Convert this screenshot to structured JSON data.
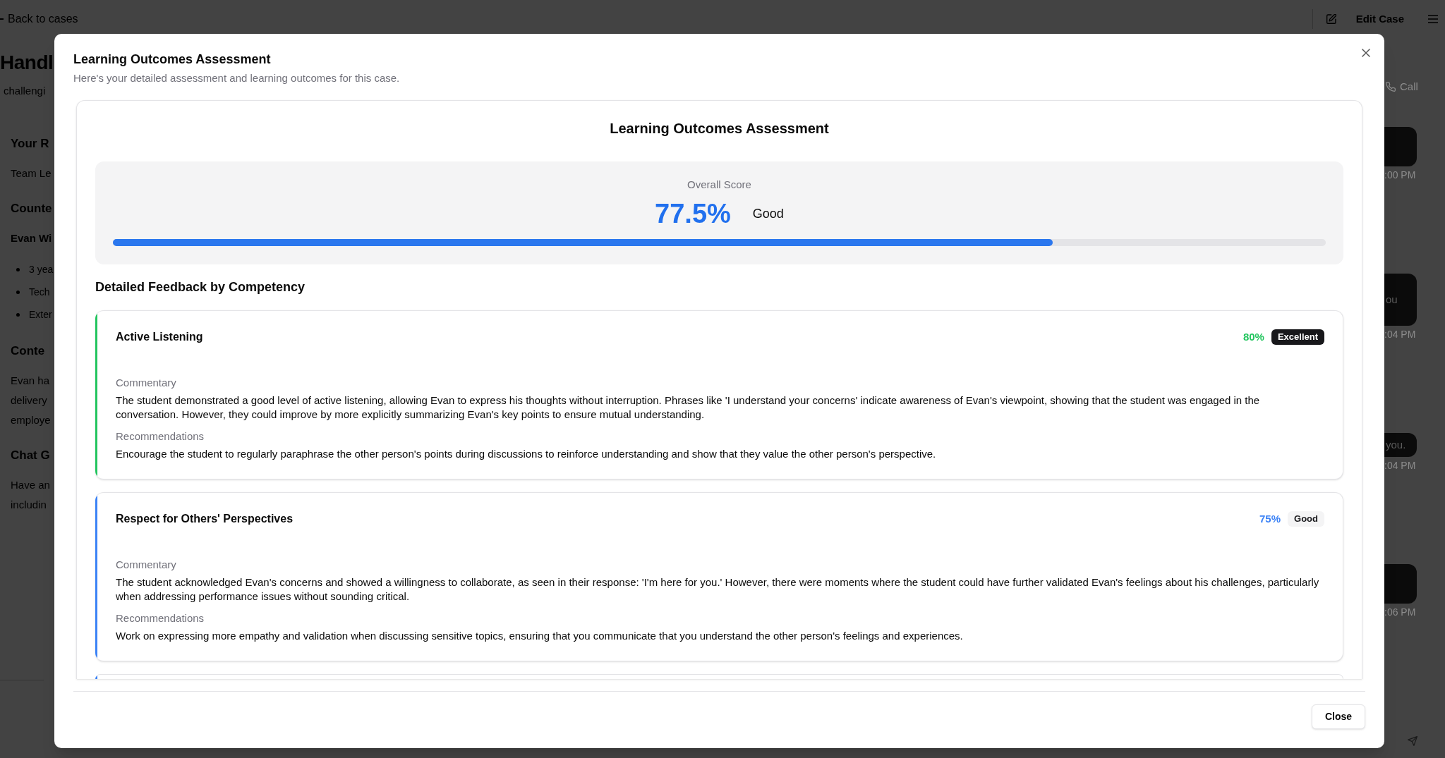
{
  "app": {
    "back_link": "Back to cases",
    "edit_button": "Edit Case",
    "case": {
      "title": "Handl",
      "subtitle": "challengi",
      "sections": [
        {
          "heading": "Your R",
          "lines": [
            "Team Le"
          ]
        },
        {
          "heading": "Counte",
          "name": "Evan Wi",
          "bullets": [
            "3 yea",
            "Tech",
            "Exter"
          ]
        },
        {
          "heading": "Conte",
          "lines": [
            "Evan ha",
            "delivery",
            "employe"
          ]
        },
        {
          "heading": "Chat G",
          "lines": [
            "Have an",
            "includin"
          ]
        }
      ]
    },
    "chat": {
      "call_button": "Call",
      "messages": [
        {
          "time": ":00 PM"
        },
        {
          "text": "ou",
          "time": ":04 PM"
        },
        {
          "text": "you.",
          "time": ":04 PM"
        },
        {
          "time": ":06 PM"
        }
      ]
    }
  },
  "dialog": {
    "title": "Learning Outcomes Assessment",
    "description": "Here's your detailed assessment and learning outcomes for this case.",
    "report": {
      "title": "Learning Outcomes Assessment",
      "overall": {
        "label": "Overall Score",
        "score": "77.5%",
        "rating": "Good",
        "level": 0.775
      },
      "feedback_heading": "Detailed Feedback by Competency",
      "competencies": [
        {
          "name": "Active Listening",
          "score": "80%",
          "badge": {
            "text": "Excellent",
            "kind": "solid"
          },
          "color": "#22c55e",
          "commentary_label": "Commentary",
          "commentary": "The student demonstrated a good level of active listening, allowing Evan to express his thoughts without interruption. Phrases like 'I understand your concerns' indicate awareness of Evan's viewpoint, showing that the student was engaged in the conversation. However, they could improve by more explicitly summarizing Evan's key points to ensure mutual understanding.",
          "recommendations_label": "Recommendations",
          "recommendations": "Encourage the student to regularly paraphrase the other person's points during discussions to reinforce understanding and show that they value the other person's perspective."
        },
        {
          "name": "Respect for Others' Perspectives",
          "score": "75%",
          "badge": {
            "text": "Good",
            "kind": "soft"
          },
          "color": "#3b82f6",
          "commentary_label": "Commentary",
          "commentary": "The student acknowledged Evan's concerns and showed a willingness to collaborate, as seen in their response: 'I'm here for you.' However, there were moments where the student could have further validated Evan's feelings about his challenges, particularly when addressing performance issues without sounding critical.",
          "recommendations_label": "Recommendations",
          "recommendations": "Work on expressing more empathy and validation when discussing sensitive topics, ensuring that you communicate that you understand the other person's feelings and experiences."
        },
        {
          "color": "#3b82f6"
        }
      ]
    },
    "close_button": "Close"
  }
}
